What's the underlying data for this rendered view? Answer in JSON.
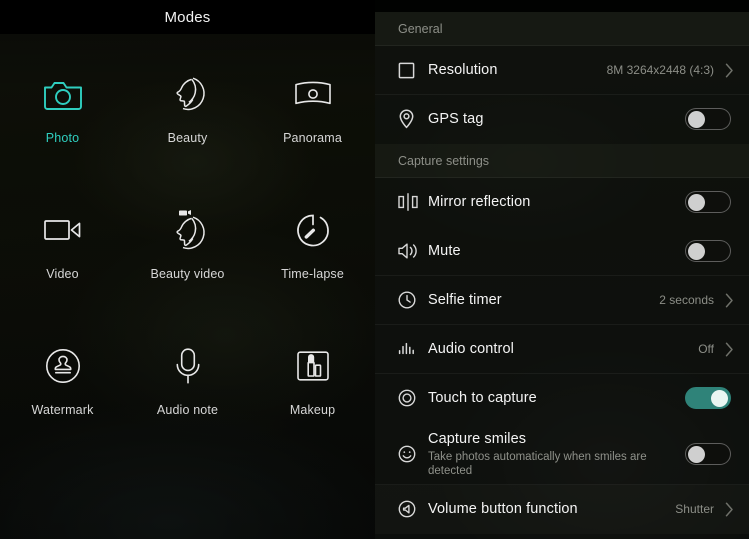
{
  "modes_panel": {
    "title": "Modes",
    "accent_color": "#2fcfc0",
    "modes": [
      {
        "label": "Photo",
        "icon": "camera-icon",
        "active": true
      },
      {
        "label": "Beauty",
        "icon": "face-beauty-icon",
        "active": false
      },
      {
        "label": "Panorama",
        "icon": "panorama-icon",
        "active": false
      },
      {
        "label": "Video",
        "icon": "video-camera-icon",
        "active": false
      },
      {
        "label": "Beauty video",
        "icon": "face-video-icon",
        "active": false
      },
      {
        "label": "Time-lapse",
        "icon": "stopwatch-icon",
        "active": false
      },
      {
        "label": "Watermark",
        "icon": "stamp-icon",
        "active": false
      },
      {
        "label": "Audio note",
        "icon": "microphone-icon",
        "active": false
      },
      {
        "label": "Makeup",
        "icon": "lipstick-icon",
        "active": false
      }
    ]
  },
  "settings_panel": {
    "toggle_on_color": "#2f8379",
    "sections": [
      {
        "header": "General",
        "rows": [
          {
            "title": "Resolution",
            "icon": "square-frame-icon",
            "value": "8M 3264x2448 (4:3)",
            "control": "chevron"
          },
          {
            "title": "GPS tag",
            "icon": "location-pin-icon",
            "control": "toggle",
            "toggle_state": "off"
          }
        ]
      },
      {
        "header": "Capture settings",
        "rows": [
          {
            "title": "Mirror reflection",
            "icon": "mirror-icon",
            "control": "toggle",
            "toggle_state": "off"
          },
          {
            "title": "Mute",
            "icon": "speaker-icon",
            "control": "toggle",
            "toggle_state": "off"
          },
          {
            "title": "Selfie timer",
            "icon": "clock-icon",
            "value": "2 seconds",
            "control": "chevron"
          },
          {
            "title": "Audio control",
            "icon": "audio-bars-icon",
            "value": "Off",
            "control": "chevron"
          },
          {
            "title": "Touch to capture",
            "icon": "target-circle-icon",
            "control": "toggle",
            "toggle_state": "on"
          },
          {
            "title": "Capture smiles",
            "subtitle": "Take photos automatically when smiles are detected",
            "icon": "smiley-icon",
            "control": "toggle",
            "toggle_state": "off"
          },
          {
            "title": "Volume button function",
            "icon": "volume-button-icon",
            "value": "Shutter",
            "control": "chevron"
          }
        ]
      }
    ]
  }
}
